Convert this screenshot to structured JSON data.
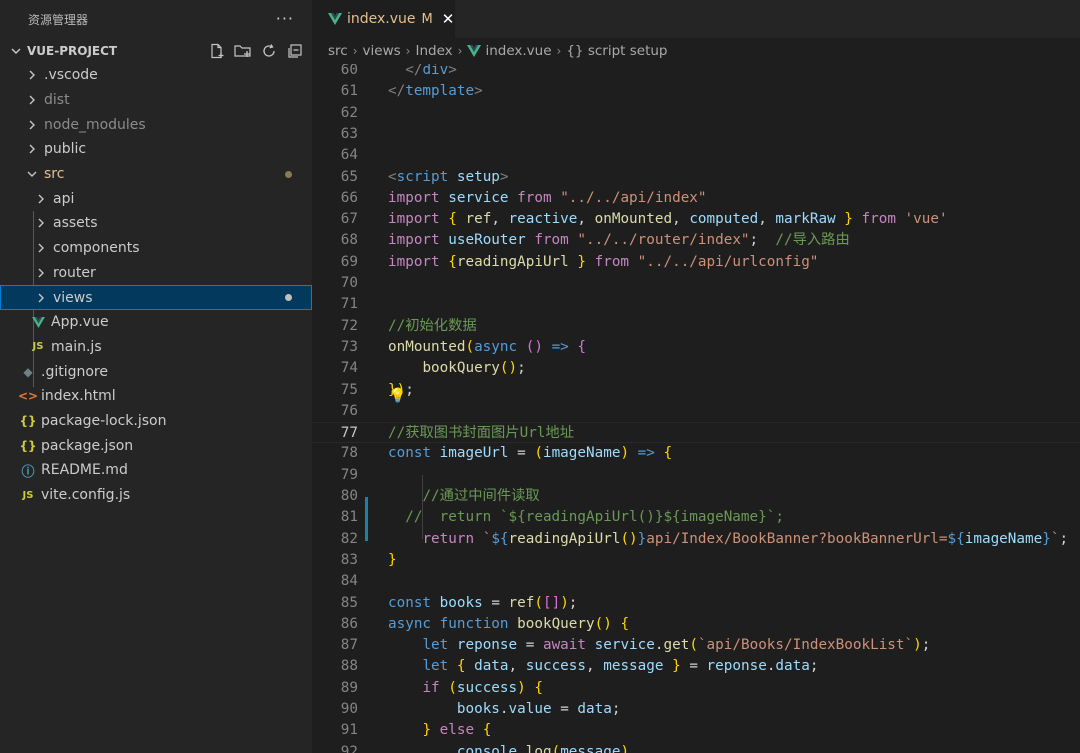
{
  "sidebar": {
    "title": "资源管理器",
    "more": "···",
    "project": "VUE-PROJECT",
    "items": [
      {
        "label": ".vscode",
        "type": "folder",
        "indent": 0,
        "dim": false
      },
      {
        "label": "dist",
        "type": "folder",
        "indent": 0,
        "dim": true
      },
      {
        "label": "node_modules",
        "type": "folder",
        "indent": 0,
        "dim": true
      },
      {
        "label": "public",
        "type": "folder",
        "indent": 0,
        "dim": false
      },
      {
        "label": "src",
        "type": "folder-open",
        "indent": 0,
        "dim": false,
        "color": "src",
        "dot": "#8b7b55"
      },
      {
        "label": "api",
        "type": "folder",
        "indent": 1
      },
      {
        "label": "assets",
        "type": "folder",
        "indent": 1
      },
      {
        "label": "components",
        "type": "folder",
        "indent": 1
      },
      {
        "label": "router",
        "type": "folder",
        "indent": 1
      },
      {
        "label": "views",
        "type": "folder",
        "indent": 1,
        "selected": true,
        "dot": "#c0c0c0"
      },
      {
        "label": "App.vue",
        "type": "vue",
        "indent": 1
      },
      {
        "label": "main.js",
        "type": "js",
        "indent": 1
      },
      {
        "label": ".gitignore",
        "type": "git",
        "indent": 0
      },
      {
        "label": "index.html",
        "type": "html",
        "indent": 0
      },
      {
        "label": "package-lock.json",
        "type": "json",
        "indent": 0
      },
      {
        "label": "package.json",
        "type": "json",
        "indent": 0
      },
      {
        "label": "README.md",
        "type": "info",
        "indent": 0
      },
      {
        "label": "vite.config.js",
        "type": "js",
        "indent": 0
      }
    ]
  },
  "tab": {
    "label": "index.vue",
    "modified": "M",
    "close": "✕"
  },
  "breadcrumb": [
    "src",
    "views",
    "Index",
    "index.vue",
    "{} script setup"
  ],
  "colors": {
    "accent": "#007fd4",
    "vue": "#41b883",
    "src_modified": "#e2c08d"
  },
  "code": {
    "current_line": 77,
    "lines": [
      {
        "n": "60",
        "t": "  </div>"
      },
      {
        "n": "61",
        "t": "</template>"
      },
      {
        "n": "62",
        "t": ""
      },
      {
        "n": "63",
        "t": ""
      },
      {
        "n": "64",
        "t": ""
      },
      {
        "n": "65",
        "t": "<script setup>"
      },
      {
        "n": "66",
        "t": "import service from \"../../api/index\""
      },
      {
        "n": "67",
        "t": "import { ref, reactive, onMounted, computed, markRaw } from 'vue'"
      },
      {
        "n": "68",
        "t": "import useRouter from \"../../router/index\";  //导入路由"
      },
      {
        "n": "69",
        "t": "import {readingApiUrl } from \"../../api/urlconfig\""
      },
      {
        "n": "70",
        "t": ""
      },
      {
        "n": "71",
        "t": ""
      },
      {
        "n": "72",
        "t": "//初始化数据"
      },
      {
        "n": "73",
        "t": "onMounted(async () => {"
      },
      {
        "n": "74",
        "t": "    bookQuery();"
      },
      {
        "n": "75",
        "t": "});"
      },
      {
        "n": "76",
        "t": ""
      },
      {
        "n": "77",
        "t": "//获取图书封面图片Url地址"
      },
      {
        "n": "78",
        "t": "const imageUrl = (imageName) => {"
      },
      {
        "n": "79",
        "t": ""
      },
      {
        "n": "80",
        "t": "    //通过中间件读取"
      },
      {
        "n": "81",
        "t": "  //  return `${readingApiUrl()}${imageName}`;"
      },
      {
        "n": "82",
        "t": "    return `${readingApiUrl()}api/Index/BookBanner?bookBannerUrl=${imageName}`;"
      },
      {
        "n": "83",
        "t": "}"
      },
      {
        "n": "84",
        "t": ""
      },
      {
        "n": "85",
        "t": "const books = ref([]);"
      },
      {
        "n": "86",
        "t": "async function bookQuery() {"
      },
      {
        "n": "87",
        "t": "    let reponse = await service.get(`api/Books/IndexBookList`);"
      },
      {
        "n": "88",
        "t": "    let { data, success, message } = reponse.data;"
      },
      {
        "n": "89",
        "t": "    if (success) {"
      },
      {
        "n": "90",
        "t": "        books.value = data;"
      },
      {
        "n": "91",
        "t": "    } else {"
      },
      {
        "n": "92",
        "t": "        console.log(message)"
      }
    ]
  }
}
